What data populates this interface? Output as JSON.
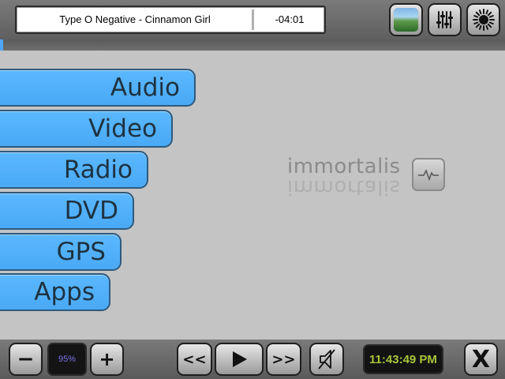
{
  "now_playing": {
    "title": "Type O Negative - Cinnamon Girl",
    "time": "-04:01"
  },
  "top_buttons": {
    "album_art": "album-art-icon",
    "equalizer": "equalizer-icon",
    "brightness": "brightness-icon"
  },
  "menu": {
    "items": [
      {
        "label": "Audio"
      },
      {
        "label": "Video"
      },
      {
        "label": "Radio"
      },
      {
        "label": "DVD"
      },
      {
        "label": "GPS"
      },
      {
        "label": "Apps"
      }
    ]
  },
  "logo": {
    "text": "immortalis",
    "icon": "heartbeat-icon"
  },
  "bottom": {
    "volume_down": "−",
    "volume": "95%",
    "volume_up": "+",
    "prev": "<<",
    "play_icon": "play-icon",
    "next": ">>",
    "mute_icon": "mute-icon",
    "clock": "11:43:49 PM",
    "close": "X"
  },
  "colors": {
    "menu_blue": "#4aabf7",
    "clock_green": "#a9c53b",
    "volume_purple": "#7a72e8",
    "background": "#c4c4c4"
  }
}
